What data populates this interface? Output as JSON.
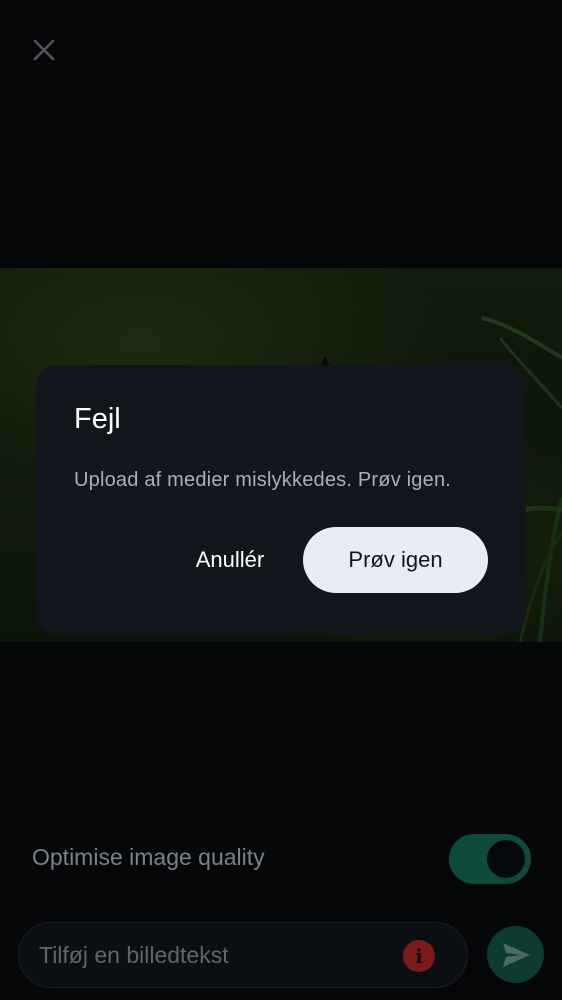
{
  "colors": {
    "background": "#06080b",
    "dialog_background": "#12151b",
    "primary_button": "#e9edf3",
    "toggle_on": "#0d4a3a",
    "error_icon": "#7a1b1b",
    "send_button": "#0d3a31"
  },
  "header": {
    "close_icon": "close-icon"
  },
  "dialog": {
    "title": "Fejl",
    "message": "Upload af medier mislykkedes. Prøv igen.",
    "cancel_label": "Anullér",
    "retry_label": "Prøv igen"
  },
  "settings": {
    "optimise_label": "Optimise image quality",
    "optimise_enabled": true
  },
  "composer": {
    "caption_placeholder": "Tilføj en billedtekst",
    "error_icon": "error-info-icon",
    "error_glyph": "i",
    "send_icon": "send-icon"
  }
}
